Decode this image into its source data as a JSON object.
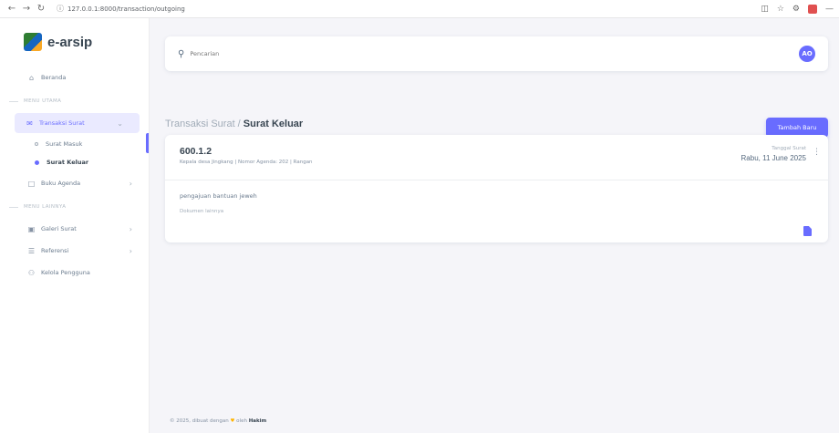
{
  "browser": {
    "url": "127.0.0.1:8000/transaction/outgoing"
  },
  "sidebar": {
    "brand": "e-arsip",
    "items": [
      {
        "label": "Beranda"
      },
      {
        "header": "MENU UTAMA"
      },
      {
        "label": "Transaksi Surat"
      },
      {
        "sub": "Surat Masuk"
      },
      {
        "sub": "Surat Keluar"
      },
      {
        "label": "Buku Agenda"
      },
      {
        "header": "MENU LAINNYA"
      },
      {
        "label": "Galeri Surat"
      },
      {
        "label": "Referensi"
      },
      {
        "label": "Kelola Pengguna"
      }
    ]
  },
  "navbar": {
    "search_placeholder": "Pencarian",
    "avatar_initials": "AO"
  },
  "heading": {
    "parent": "Transaksi Surat",
    "separator": " / ",
    "current": "Surat Keluar"
  },
  "add_button": "Tambah Baru",
  "letter": {
    "number": "600.1.2",
    "meta": "Kepala desa Jingkang | Nomor Agenda: 202 | Rangan",
    "date_label": "Tanggal Surat",
    "date": "Rabu, 11 June 2025",
    "subject": "pengajuan bantuan jeweh",
    "attachment_label": "Dokumen lainnya"
  },
  "footer": {
    "prefix": "© 2025, dibuat dengan ",
    "heart": "♥",
    "middle": " oleh ",
    "author": "Hakim"
  },
  "colors": {
    "primary": "#696cff",
    "background": "#f5f5f9"
  }
}
